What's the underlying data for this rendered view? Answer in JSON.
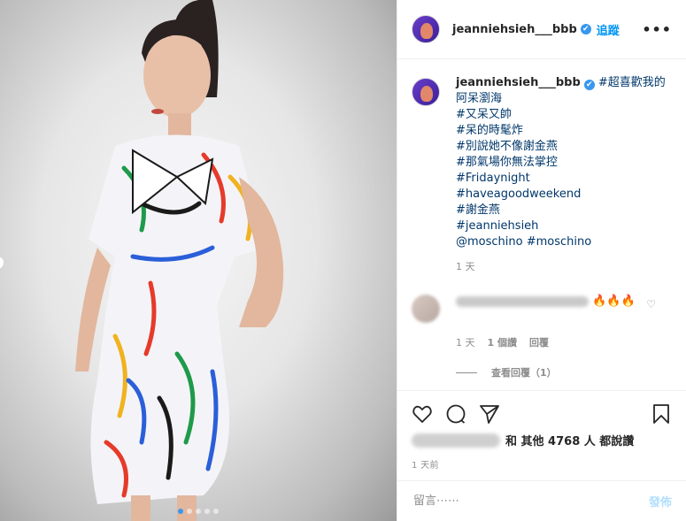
{
  "post": {
    "username": "jeanniehsieh___bbb",
    "follow_label": "追蹤",
    "more_label": "•••",
    "verified_glyph": "✔"
  },
  "caption": {
    "username": "jeanniehsieh___bbb",
    "first_line": "#超喜歡我的阿呆瀏海",
    "tags": [
      "#又呆又帥",
      "#呆的時髦炸",
      "#別說她不像謝金燕",
      "#那氣場你無法掌控",
      "#Fridaynight",
      "#haveagoodweekend",
      "#謝金燕",
      "#jeanniehsieh"
    ],
    "mention": "@moschino",
    "last_tag": "#moschino",
    "age": "1 天"
  },
  "comment": {
    "text": "🔥🔥🔥",
    "age": "1 天",
    "likes": "1 個讚",
    "reply": "回覆",
    "view_replies": "查看回覆（1）"
  },
  "likes_text": "和 其他 4768 人 都說讚",
  "timestamp": "1 天前",
  "add_comment": {
    "placeholder": "留言⋯⋯",
    "post_label": "發佈"
  },
  "colors": {
    "accent": "#0095f6",
    "verified": "#3897f0",
    "post_disabled": "#b2dffc"
  }
}
